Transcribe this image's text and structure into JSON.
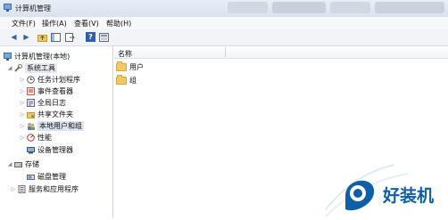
{
  "window": {
    "title": "计算机管理"
  },
  "menu": {
    "file": "文件(F)",
    "action": "操作(A)",
    "view": "查看(V)",
    "help": "帮助(H)"
  },
  "tree": {
    "root": "计算机管理(本地)",
    "system_tools": "系统工具",
    "task_scheduler": "任务计划程序",
    "event_viewer": "事件查看器",
    "global_logs": "全局日志",
    "shared_folders": "共享文件夹",
    "local_users": "本地用户和组",
    "performance": "性能",
    "device_manager": "设备管理器",
    "storage": "存储",
    "disk_management": "磁盘管理",
    "services": "服务和应用程序"
  },
  "list": {
    "column_name": "名称",
    "items": [
      "用户",
      "组"
    ]
  },
  "watermark": {
    "text": "好装机"
  },
  "colors": {
    "accent": "#2f5fa8",
    "folder": "#f2c768",
    "watermark": "#0f5fa8"
  }
}
